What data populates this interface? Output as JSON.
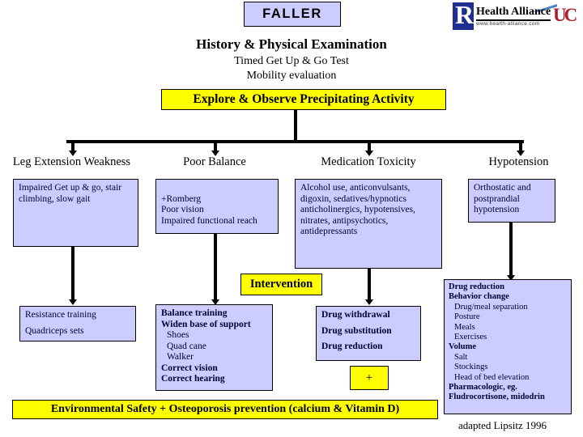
{
  "title_box": {
    "label": "FALLER"
  },
  "branding": {
    "health_alliance_name": "Health Alliance",
    "health_alliance_url": "www.health-alliance.com",
    "health_alliance_mark": "R",
    "uc_monogram": "UC"
  },
  "header": {
    "main_title": "History & Physical Examination",
    "sub_lines": [
      "Timed Get Up & Go Test",
      "Mobility evaluation"
    ]
  },
  "explore_banner": {
    "label": "Explore & Observe Precipitating Activity"
  },
  "columns": [
    {
      "label": "Leg Extension Weakness",
      "findings": "Impaired Get up & go, stair climbing, slow gait",
      "intervention_lines": [
        {
          "text": "Resistance training",
          "bold": false,
          "indent": false,
          "space_after": true
        },
        {
          "text": "Quadriceps sets",
          "bold": false,
          "indent": false,
          "space_after": false
        }
      ]
    },
    {
      "label": "Poor Balance",
      "findings": "+Romberg\nPoor vision\nImpaired functional reach",
      "intervention_lines": [
        {
          "text": "Balance training",
          "bold": true,
          "indent": false,
          "space_after": false
        },
        {
          "text": "Widen base of support",
          "bold": true,
          "indent": false,
          "space_after": false
        },
        {
          "text": "Shoes",
          "bold": false,
          "indent": true,
          "space_after": false
        },
        {
          "text": "Quad cane",
          "bold": false,
          "indent": true,
          "space_after": false
        },
        {
          "text": "Walker",
          "bold": false,
          "indent": true,
          "space_after": false
        },
        {
          "text": "Correct vision",
          "bold": true,
          "indent": false,
          "space_after": false
        },
        {
          "text": "Correct hearing",
          "bold": true,
          "indent": false,
          "space_after": false
        }
      ]
    },
    {
      "label": "Medication Toxicity",
      "findings": "Alcohol use, anticonvulsants, digoxin, sedatives/hypnotics anticholinergics, hypotensives, nitrates, antipsychotics, antidepressants",
      "intervention_lines": [
        {
          "text": "Drug withdrawal",
          "bold": true,
          "indent": false,
          "space_after": true
        },
        {
          "text": "Drug substitution",
          "bold": true,
          "indent": false,
          "space_after": true
        },
        {
          "text": "Drug reduction",
          "bold": true,
          "indent": false,
          "space_after": false
        }
      ]
    },
    {
      "label": "Hypotension",
      "findings": "Orthostatic and postprandial hypotension",
      "intervention_lines": [
        {
          "text": "Drug reduction",
          "bold": true,
          "indent": false,
          "space_after": false
        },
        {
          "text": "Behavior change",
          "bold": true,
          "indent": false,
          "space_after": false
        },
        {
          "text": "Drug/meal separation",
          "bold": false,
          "indent": true,
          "space_after": false
        },
        {
          "text": "Posture",
          "bold": false,
          "indent": true,
          "space_after": false
        },
        {
          "text": "Meals",
          "bold": false,
          "indent": true,
          "space_after": false
        },
        {
          "text": "Exercises",
          "bold": false,
          "indent": true,
          "space_after": false
        },
        {
          "text": "Volume",
          "bold": true,
          "indent": false,
          "space_after": false
        },
        {
          "text": "Salt",
          "bold": false,
          "indent": true,
          "space_after": false
        },
        {
          "text": "Stockings",
          "bold": false,
          "indent": true,
          "space_after": false
        },
        {
          "text": "Head of bed elevation",
          "bold": false,
          "indent": true,
          "space_after": false
        },
        {
          "text": "Pharmacologic, eg.",
          "bold": true,
          "indent": false,
          "space_after": false
        },
        {
          "text": "Fludrocortisone, midodrin",
          "bold": true,
          "indent": false,
          "space_after": false
        }
      ]
    }
  ],
  "intervention_banner": {
    "label": "Intervention"
  },
  "plus_box": {
    "label": "+"
  },
  "footer_banner": {
    "label": "Environmental Safety + Osteoporosis prevention (calcium & Vitamin D)"
  },
  "credit": {
    "label": "adapted Lipsitz 1996"
  },
  "colors": {
    "box_fill": "#ccccff",
    "banner_fill": "#ffff00",
    "border": "#000000",
    "text": "#000033",
    "brand_blue": "#1f2f8f",
    "brand_red": "#b01c2e"
  }
}
